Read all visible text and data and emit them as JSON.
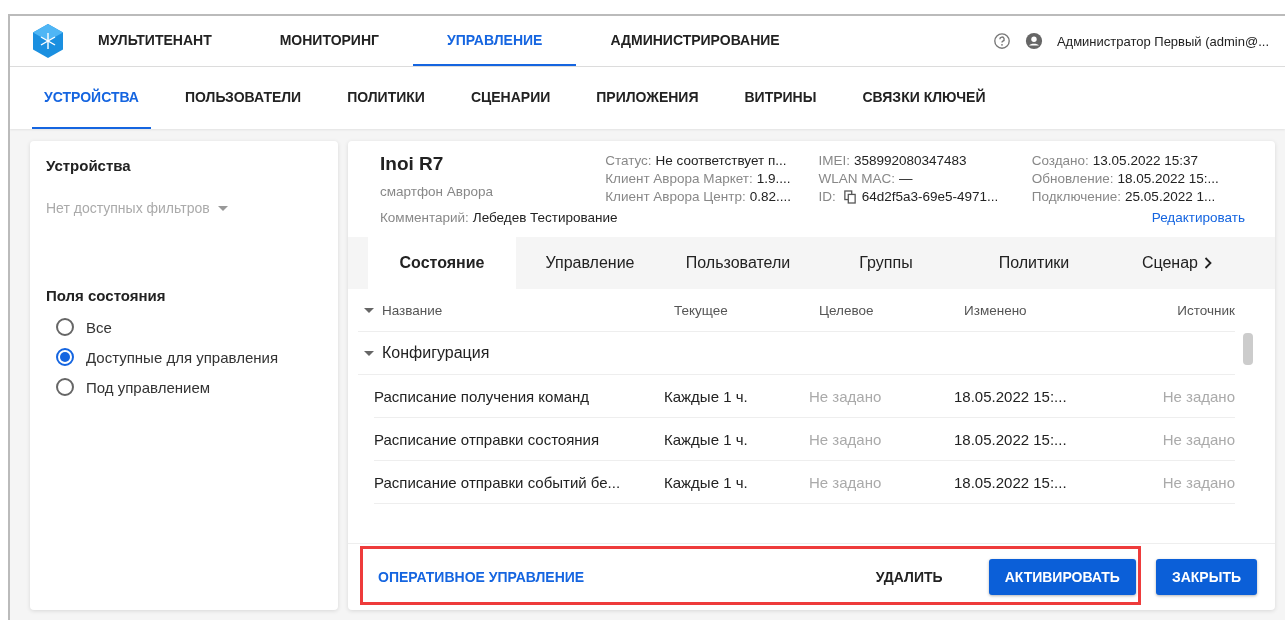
{
  "top_nav": [
    {
      "label": "МУЛЬТИТЕНАНТ",
      "selected": false
    },
    {
      "label": "МОНИТОРИНГ",
      "selected": false
    },
    {
      "label": "УПРАВЛЕНИЕ",
      "selected": true
    },
    {
      "label": "АДМИНИСТРИРОВАНИЕ",
      "selected": false
    }
  ],
  "user": {
    "name": "Администратор Первый (admin@..."
  },
  "sub_nav": [
    {
      "label": "УСТРОЙСТВА",
      "selected": true
    },
    {
      "label": "ПОЛЬЗОВАТЕЛИ",
      "selected": false
    },
    {
      "label": "ПОЛИТИКИ",
      "selected": false
    },
    {
      "label": "СЦЕНАРИИ",
      "selected": false
    },
    {
      "label": "ПРИЛОЖЕНИЯ",
      "selected": false
    },
    {
      "label": "ВИТРИНЫ",
      "selected": false
    },
    {
      "label": "СВЯЗКИ КЛЮЧЕЙ",
      "selected": false
    }
  ],
  "sidebar": {
    "title": "Устройства",
    "filter": "Нет доступных фильтров",
    "section_title": "Поля состояния",
    "options": [
      {
        "label": "Все",
        "selected": false
      },
      {
        "label": "Доступные для управления",
        "selected": true
      },
      {
        "label": "Под управлением",
        "selected": false
      }
    ]
  },
  "device": {
    "name": "Inoi R7",
    "type": "смартфон Аврора",
    "comment": {
      "label": "Комментарий:",
      "value": "Лебедев Тестирование"
    },
    "columns": [
      [
        {
          "label": "Статус:",
          "value": "Не соответствует п..."
        },
        {
          "label": "Клиент Аврора Маркет:",
          "value": "1.9...."
        },
        {
          "label": "Клиент Аврора Центр:",
          "value": "0.82...."
        }
      ],
      [
        {
          "label": "IMEI:",
          "value": "358992080347483"
        },
        {
          "label": "WLAN MAC:",
          "value": "—"
        },
        {
          "label": "ID:",
          "value": "64d2f5a3-69e5-4971...",
          "kind": "copy"
        }
      ],
      [
        {
          "label": "Создано:",
          "value": "13.05.2022 15:37"
        },
        {
          "label": "Обновление:",
          "value": "18.05.2022 15:..."
        },
        {
          "label": "Подключение:",
          "value": "25.05.2022 1..."
        }
      ]
    ],
    "edit_link": "Редактировать"
  },
  "tabs": [
    {
      "label": "Состояние",
      "selected": true
    },
    {
      "label": "Управление",
      "selected": false
    },
    {
      "label": "Пользователи",
      "selected": false
    },
    {
      "label": "Группы",
      "selected": false
    },
    {
      "label": "Политики",
      "selected": false
    },
    {
      "label": "Сценар",
      "selected": false
    }
  ],
  "table": {
    "columns": [
      "Название",
      "Текущее",
      "Целевое",
      "Изменено",
      "Источник"
    ],
    "group": "Конфигурация",
    "rows": [
      [
        "Расписание получения команд",
        "Каждые 1 ч.",
        "Не задано",
        "18.05.2022 15:...",
        "Не задано"
      ],
      [
        "Расписание отправки состояния",
        "Каждые 1 ч.",
        "Не задано",
        "18.05.2022 15:...",
        "Не задано"
      ],
      [
        "Расписание отправки событий бе...",
        "Каждые 1 ч.",
        "Не задано",
        "18.05.2022 15:...",
        "Не задано"
      ]
    ]
  },
  "footer": {
    "link": "ОПЕРАТИВНОЕ УПРАВЛЕНИЕ",
    "buttons": [
      {
        "label": "УДАЛИТЬ",
        "kind": "text"
      },
      {
        "label": "АКТИВИРОВАТЬ",
        "kind": "primary"
      },
      {
        "label": "ЗАКРЫТЬ",
        "kind": "primary"
      }
    ]
  }
}
